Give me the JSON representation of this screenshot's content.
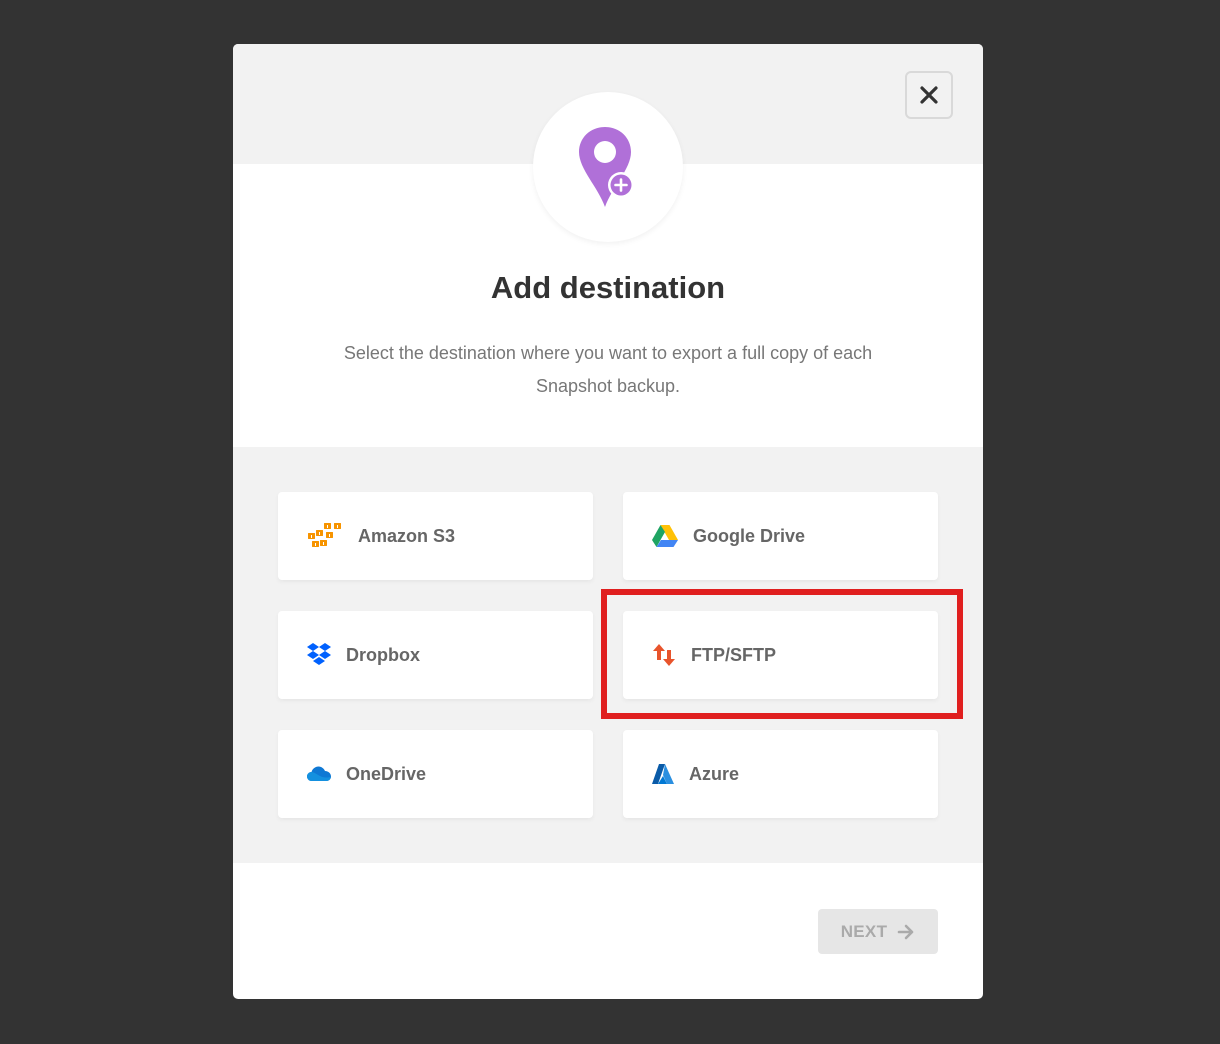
{
  "modal": {
    "title": "Add destination",
    "description": "Select the destination where you want to export a full copy of each Snapshot backup.",
    "close_icon": "close-icon",
    "hero_icon": "location-pin-plus-icon"
  },
  "options": [
    {
      "label": "Amazon S3",
      "icon": "amazon-s3-icon"
    },
    {
      "label": "Google Drive",
      "icon": "google-drive-icon"
    },
    {
      "label": "Dropbox",
      "icon": "dropbox-icon"
    },
    {
      "label": "FTP/SFTP",
      "icon": "ftp-transfer-icon",
      "highlighted": true
    },
    {
      "label": "OneDrive",
      "icon": "onedrive-icon"
    },
    {
      "label": "Azure",
      "icon": "azure-icon"
    }
  ],
  "footer": {
    "next_label": "NEXT",
    "next_icon": "arrow-right-icon"
  },
  "colors": {
    "backdrop": "#333333",
    "hero_purple": "#b070d8",
    "highlight_red": "#e01f1f",
    "ftp_orange": "#e8542c",
    "aws_orange": "#f79400",
    "dropbox_blue": "#0061fe",
    "onedrive_blue": "#0f78d4",
    "azure_blue": "#0078d4"
  }
}
